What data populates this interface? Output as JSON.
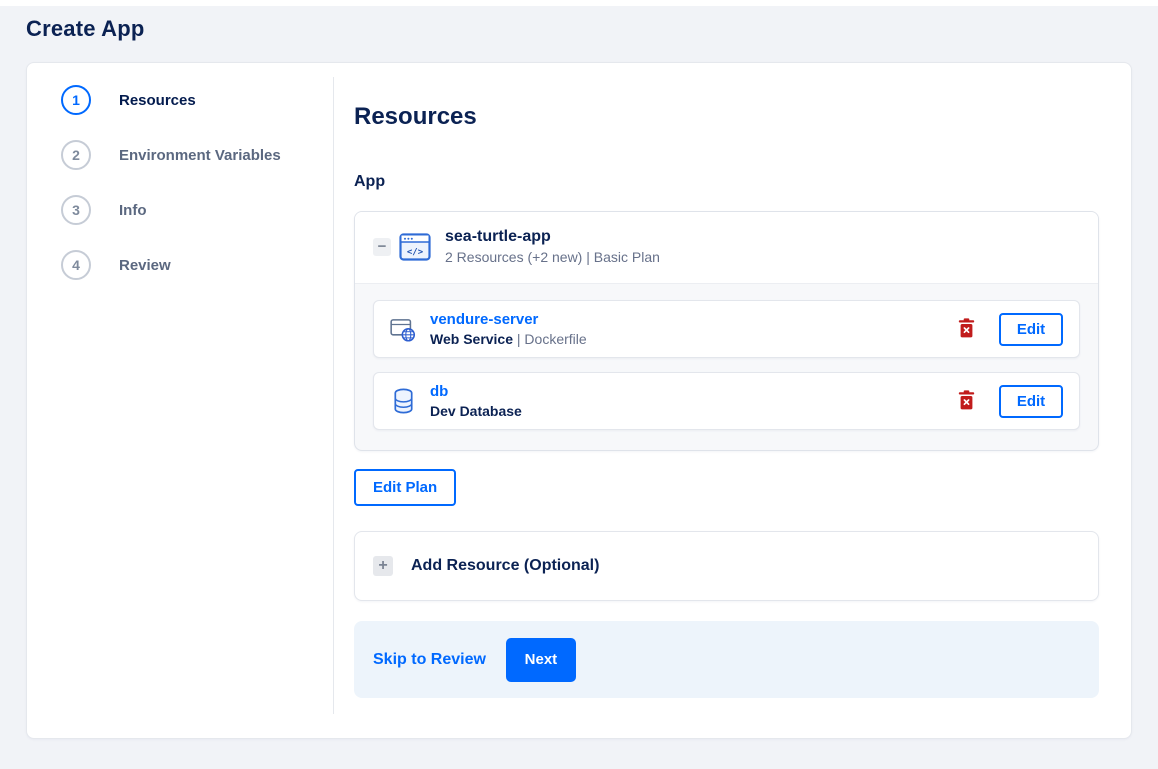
{
  "page": {
    "title": "Create App"
  },
  "colors": {
    "accent_blue": "#0069ff",
    "navy_text": "#031b4e",
    "muted_text": "#67718a",
    "danger_red": "#c11c1c",
    "page_background": "#f1f3f7",
    "footer_background": "#edf4fb"
  },
  "stepper": {
    "steps": [
      {
        "number": "1",
        "label": "Resources",
        "active": true
      },
      {
        "number": "2",
        "label": "Environment Variables",
        "active": false
      },
      {
        "number": "3",
        "label": "Info",
        "active": false
      },
      {
        "number": "4",
        "label": "Review",
        "active": false
      }
    ]
  },
  "main": {
    "heading": "Resources",
    "section_label": "App",
    "app_card": {
      "collapse_icon": "minus-icon",
      "app_icon": "app-window-code-icon",
      "name": "sea-turtle-app",
      "subtitle": "2 Resources (+2 new) | Basic Plan",
      "resources": [
        {
          "icon": "web-service-globe-icon",
          "name": "vendure-server",
          "type": "Web Service",
          "detail": " | Dockerfile",
          "delete_icon": "trash-icon",
          "edit_label": "Edit"
        },
        {
          "icon": "database-cylinder-icon",
          "name": "db",
          "type": "Dev Database",
          "detail": "",
          "delete_icon": "trash-icon",
          "edit_label": "Edit"
        }
      ]
    },
    "edit_plan_label": "Edit Plan",
    "add_resource": {
      "icon": "plus-icon",
      "label": "Add Resource (Optional)"
    },
    "footer": {
      "skip_label": "Skip to Review",
      "next_label": "Next"
    }
  }
}
